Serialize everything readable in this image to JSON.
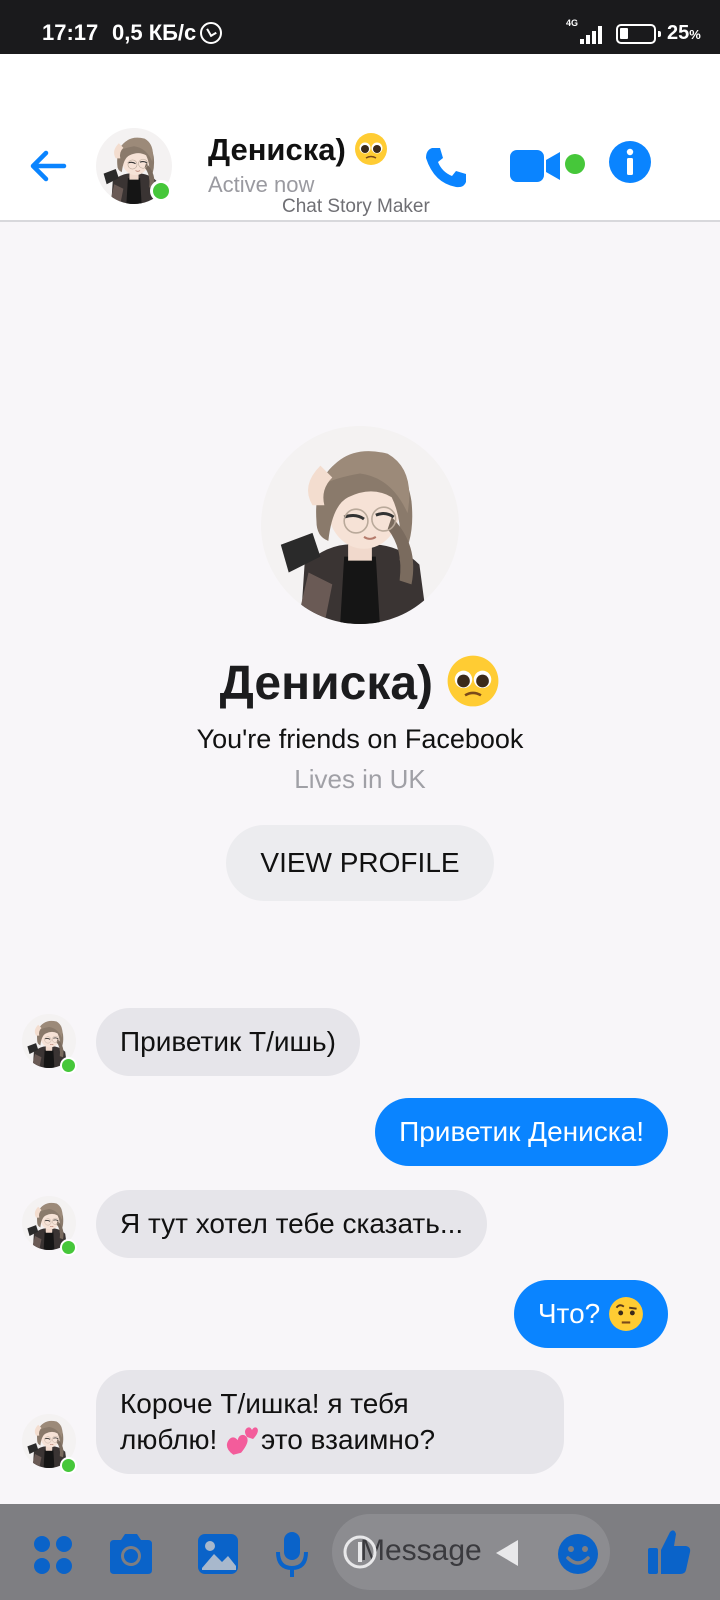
{
  "status_bar": {
    "time": "17:17",
    "speed": "0,5 КБ/с",
    "network": "4G",
    "battery": "25",
    "battery_unit": "%"
  },
  "header": {
    "contact_name": "Дениска)",
    "status": "Active now",
    "watermark": "Chat Story Maker",
    "accent_color": "#0a84ff",
    "online_color": "#46c73a"
  },
  "profile": {
    "name": "Дениска)",
    "friends_text": "You're friends on Facebook",
    "lives_text": "Lives in UK",
    "view_profile_label": "VIEW PROFILE"
  },
  "messages": [
    {
      "from": "them",
      "text": "Приветик Т/ишь)"
    },
    {
      "from": "me",
      "text": "Приветик Дениска!"
    },
    {
      "from": "them",
      "text": "Я тут хотел  тебе сказать..."
    },
    {
      "from": "me",
      "text": "Что?"
    },
    {
      "from": "them",
      "line1": "Короче Т/ишка! я  тебя",
      "line2a": "люблю!",
      "line2b": "это взаимно?"
    }
  ],
  "composer": {
    "placeholder": "Message",
    "icons": [
      "apps-icon",
      "camera-icon",
      "gallery-icon",
      "microphone-icon",
      "emoji-icon",
      "like-icon"
    ]
  }
}
